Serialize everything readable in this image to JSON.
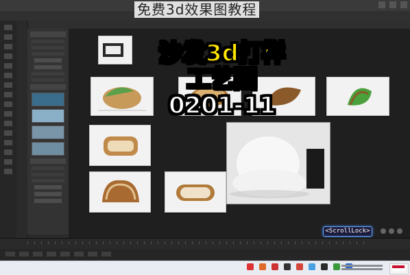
{
  "watermark": "免费3d效果图教程",
  "overlay": {
    "line1": "沙发3d打样",
    "line2": "工艺图",
    "line3": "0201-11"
  },
  "viewport": {
    "scroll_lock_label": "<ScrollLock>"
  },
  "colors": {
    "title_fill": "#ffe400",
    "title_white": "#ffffff",
    "scroll_border": "#6fa8ff",
    "background": "#2b2b2b"
  },
  "icons": [
    "minimize-icon",
    "maximize-icon",
    "close-icon",
    "nav-gizmo-icon"
  ]
}
